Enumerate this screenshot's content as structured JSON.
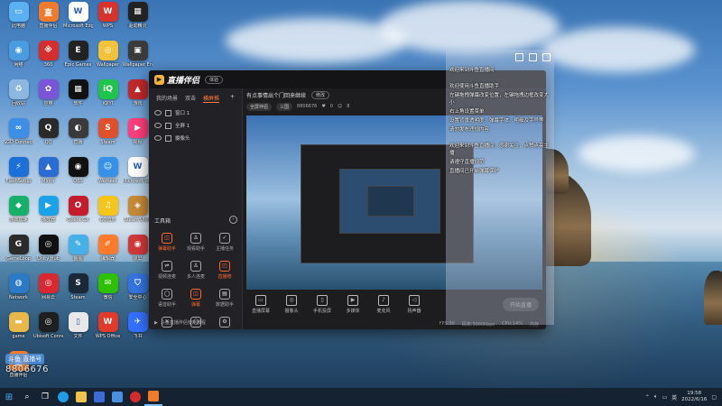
{
  "desktop": {
    "icons": [
      {
        "label": "此电脑",
        "icon": "computer-icon",
        "color": "#5ab0f0",
        "glyph": "▭"
      },
      {
        "label": "直播伴侣",
        "icon": "streaming-app-icon",
        "color": "#f07b2a",
        "glyph": "直"
      },
      {
        "label": "Microsoft Edge",
        "icon": "document-icon",
        "color": "#ffffff",
        "glyph": "W"
      },
      {
        "label": "WPS",
        "icon": "wps-icon",
        "color": "#d7332b",
        "glyph": "W"
      },
      {
        "label": "驱动精灵",
        "icon": "driver-icon",
        "color": "#222",
        "glyph": "▦"
      },
      {
        "label": "网络",
        "icon": "network-icon",
        "color": "#4a9be0",
        "glyph": "◉"
      },
      {
        "label": "360",
        "icon": "game-icon",
        "color": "#d72d2d",
        "glyph": "※"
      },
      {
        "label": "Epic Games",
        "icon": "epic-icon",
        "color": "#222",
        "glyph": "E"
      },
      {
        "label": "Wallpaper",
        "icon": "owl-icon",
        "color": "#f2c23a",
        "glyph": "◎"
      },
      {
        "label": "Wallpaper Engine",
        "icon": "wallpaper-icon",
        "color": "#3a3a3a",
        "glyph": "▣"
      },
      {
        "label": "回收站",
        "icon": "recycle-bin-icon",
        "color": "#8cb8e0",
        "glyph": "♻"
      },
      {
        "label": "应用",
        "icon": "colorful-app-icon",
        "color": "#7a55d8",
        "glyph": "✿"
      },
      {
        "label": "软件",
        "icon": "black-app-icon",
        "color": "#111",
        "glyph": "▦"
      },
      {
        "label": "iQIYI",
        "icon": "iqiyi-icon",
        "color": "#1ec54a",
        "glyph": "iQ"
      },
      {
        "label": "游戏",
        "icon": "game-red-icon",
        "color": "#c0282a",
        "glyph": "▲"
      },
      {
        "label": "SGD Connect",
        "icon": "link-icon",
        "color": "#3d8ee6",
        "glyph": "∞"
      },
      {
        "label": "QQ",
        "icon": "qq-icon",
        "color": "#2a2a2a",
        "glyph": "Q"
      },
      {
        "label": "直播",
        "icon": "live-icon",
        "color": "#3a3a3a",
        "glyph": "◐"
      },
      {
        "label": "Steam",
        "icon": "steam-red-icon",
        "color": "#e0502a",
        "glyph": "S"
      },
      {
        "label": "视频",
        "icon": "play-icon",
        "color": "#ff3d7a",
        "glyph": "▶"
      },
      {
        "label": "FlashSetup",
        "icon": "flash-icon",
        "color": "#1c6fd9",
        "glyph": "⚡"
      },
      {
        "label": "Mirror",
        "icon": "mirror-icon",
        "color": "#2a6cd1",
        "glyph": "▲"
      },
      {
        "label": "OBS",
        "icon": "obs-icon",
        "color": "#111",
        "glyph": "◉"
      },
      {
        "label": "Wemeet",
        "icon": "meeting-icon",
        "color": "#3592e8",
        "glyph": "☺"
      },
      {
        "label": "Microsoft Word",
        "icon": "word-doc-icon",
        "color": "#ffffff",
        "glyph": "W"
      },
      {
        "label": "游戏加速",
        "icon": "accelerator-icon",
        "color": "#17b06a",
        "glyph": "◆"
      },
      {
        "label": "播放器",
        "icon": "player-icon",
        "color": "#1aa3e8",
        "glyph": "▶"
      },
      {
        "label": "Opera GX",
        "icon": "opera-icon",
        "color": "#c51c2c",
        "glyph": "O"
      },
      {
        "label": "QQ音乐",
        "icon": "music-icon",
        "color": "#f5c518",
        "glyph": "♫"
      },
      {
        "label": "Steam Ultra",
        "icon": "gem-icon",
        "color": "#c48a35",
        "glyph": "◈"
      },
      {
        "label": "GameLoop",
        "icon": "gameloop-icon",
        "color": "#2b2b2b",
        "glyph": "G"
      },
      {
        "label": "Unity Hub",
        "icon": "unity-icon",
        "color": "#111",
        "glyph": "◎"
      },
      {
        "label": "画图",
        "icon": "paint-icon",
        "color": "#46b0e8",
        "glyph": "✎"
      },
      {
        "label": "编辑器",
        "icon": "editor-icon",
        "color": "#ff7a2a",
        "glyph": "✐"
      },
      {
        "label": "录屏",
        "icon": "record-icon",
        "color": "#d2383a",
        "glyph": "◉"
      },
      {
        "label": "Network",
        "icon": "globe-icon",
        "color": "#2c79c8",
        "glyph": "◍"
      },
      {
        "label": "网易云",
        "icon": "netease-icon",
        "color": "#d9282f",
        "glyph": "◎"
      },
      {
        "label": "Steam",
        "icon": "steam-icon",
        "color": "#1b2838",
        "glyph": "S"
      },
      {
        "label": "微信",
        "icon": "wechat-icon",
        "color": "#2dc100",
        "glyph": "✉"
      },
      {
        "label": "安全中心",
        "icon": "shield-icon",
        "color": "#3573e0",
        "glyph": "⛉"
      },
      {
        "label": "game",
        "icon": "folder-icon",
        "color": "#e8b84a",
        "glyph": "▬"
      },
      {
        "label": "Ubisoft Connect",
        "icon": "ubisoft-icon",
        "color": "#1f1f1f",
        "glyph": "◎"
      },
      {
        "label": "文件",
        "icon": "file-icon",
        "color": "#e8e8e8",
        "glyph": "▯"
      },
      {
        "label": "WPS Office",
        "icon": "wps-office-icon",
        "color": "#e13a2b",
        "glyph": "W"
      },
      {
        "label": "飞书",
        "icon": "feishu-icon",
        "color": "#3470ff",
        "glyph": "✈"
      },
      {
        "label": "直播伴侣",
        "icon": "streaming-app-icon",
        "color": "#f07b2a",
        "glyph": "直"
      }
    ]
  },
  "app": {
    "title": "直播伴侣",
    "beta": "体验",
    "sidebar": {
      "tabs": [
        "我的场景",
        "双击",
        "横屏推"
      ],
      "active_tab_index": 2,
      "add": "+",
      "scenes": [
        "窗口 1",
        "全屏 1",
        "摄像头"
      ],
      "tools_header": "工具箱",
      "tools": [
        {
          "label": "弹幕助手",
          "icon": "chat-bubble-icon",
          "hot": true,
          "glyph": "◫"
        },
        {
          "label": "观看助手",
          "icon": "person-icon",
          "hot": false,
          "glyph": "♙"
        },
        {
          "label": "主播任务",
          "icon": "task-icon",
          "hot": false,
          "glyph": "✓"
        },
        {
          "label": "视频连麦",
          "icon": "video-link-icon",
          "hot": false,
          "glyph": "⇌"
        },
        {
          "label": "多人连麦",
          "icon": "group-icon",
          "hot": false,
          "glyph": "♙"
        },
        {
          "label": "直播榜",
          "icon": "ranking-icon",
          "hot": true,
          "glyph": "◰"
        },
        {
          "label": "语音助手",
          "icon": "voice-icon",
          "hot": false,
          "glyph": "◯"
        },
        {
          "label": "弹幕",
          "icon": "danmaku-icon",
          "hot": true,
          "glyph": "◫"
        },
        {
          "label": "数据助手",
          "icon": "data-icon",
          "hot": false,
          "glyph": "▤"
        },
        {
          "label": "PK",
          "icon": "pk-icon",
          "hot": false,
          "glyph": "✕"
        },
        {
          "label": "更多",
          "icon": "more-icon",
          "hot": false,
          "glyph": "◯"
        },
        {
          "label": "设置",
          "icon": "settings-icon",
          "hot": false,
          "glyph": "⚙"
        }
      ],
      "footer": "斗鱼直播伴侣使用教程"
    },
    "main": {
      "room_title": "有点事情出个门回来继续",
      "edit": "修改",
      "pills": [
        "全屏伴侣",
        "三国"
      ],
      "room_id": "8806676",
      "likes": "0",
      "viewers": "8"
    },
    "bottom_tools": [
      {
        "label": "直播屏幕",
        "icon": "screen-icon",
        "glyph": "▭"
      },
      {
        "label": "摄像头",
        "icon": "camera-icon",
        "glyph": "◎"
      },
      {
        "label": "手机投屏",
        "icon": "phone-cast-icon",
        "glyph": "▯"
      },
      {
        "label": "多媒体",
        "icon": "media-icon",
        "glyph": "▶"
      },
      {
        "label": "麦克风",
        "icon": "mic-icon",
        "glyph": "♪"
      },
      {
        "label": "扬声器",
        "icon": "speaker-icon",
        "glyph": "◁"
      }
    ],
    "start_live": "开始直播",
    "status": [
      "FPS:30",
      "码率:3000kbps",
      "CPU:14%",
      "内存"
    ]
  },
  "chat_panel": {
    "lines": [
      "欢迎来到斗鱼直播间",
      "",
      "欢迎使用斗鱼直播助手",
      "左键拖拽弹幕改变位置，左键拖拽边框改变大小",
      "右上角设置菜单",
      "设置背景透明度、弹幕字体、粗细及字号等",
      "请勿发布违规内容",
      "",
      "欢迎来到斗鱼直播间，感谢关注，点赞点亮主播",
      "请遵守直播规范",
      "直播间已开启弹幕保护"
    ]
  },
  "watermark": {
    "brand": "斗鱼 直播号",
    "room_id": "8806676"
  },
  "taskbar": {
    "search_icon": "search-icon",
    "time": "19:58",
    "date": "2022/6/16",
    "lang": "英"
  }
}
